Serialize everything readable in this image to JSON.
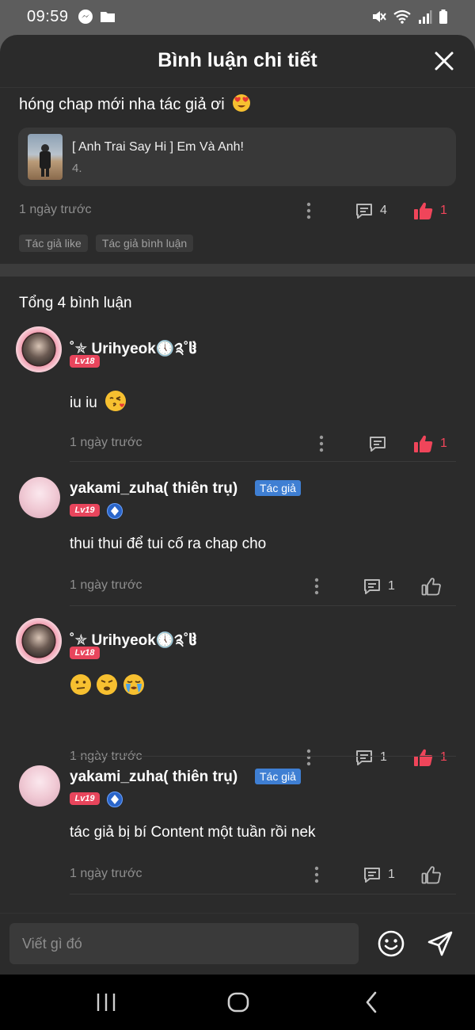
{
  "status_bar": {
    "time": "09:59"
  },
  "header": {
    "title": "Bình luận chi tiết"
  },
  "parent_comment": {
    "text": "hóng chap mới nha tác giả ơi",
    "story_title": "[ Anh Trai Say Hi ] Em Và Anh!",
    "story_chapter": "4.",
    "time": "1 ngày trước",
    "reply_count": "4",
    "like_count": "1",
    "tags": [
      "Tác giả like",
      "Tác giả bình luận"
    ]
  },
  "replies": {
    "total_label": "Tổng 4 bình luận",
    "items": [
      {
        "username": "˚✯ Urihyeok🕔༉˚ჱ̒",
        "level": "Lv18",
        "text": "iu iu",
        "time": "1 ngày trước",
        "reply_count": "",
        "like_count": "1",
        "liked": true
      },
      {
        "username": "yakami_zuha( thiên trụ)",
        "author_badge": "Tác giả",
        "level": "Lv19",
        "text": "thui thui để tui cố ra chap cho",
        "time": "1 ngày trước",
        "reply_count": "1",
        "like_count": "",
        "liked": false
      },
      {
        "username": "˚✯ Urihyeok🕔༉˚ჱ̒",
        "level": "Lv18",
        "text": "",
        "time": "1 ngày trước",
        "reply_count": "1",
        "like_count": "1",
        "liked": true
      },
      {
        "username": "yakami_zuha( thiên trụ)",
        "author_badge": "Tác giả",
        "level": "Lv19",
        "text": "tác giả bị bí Content một tuần rồi nek",
        "time": "1 ngày trước",
        "reply_count": "1",
        "like_count": "",
        "liked": false
      }
    ]
  },
  "input": {
    "placeholder": "Viết gì đó"
  },
  "colors": {
    "accent_red": "#f0455a",
    "author_blue": "#3f7fd3",
    "sheet_bg": "#2b2b2b"
  },
  "icons": [
    "messenger-icon",
    "folder-icon",
    "mute-icon",
    "wifi-icon",
    "signal-icon",
    "battery-icon",
    "close-icon",
    "more-vertical-icon",
    "comment-icon",
    "thumb-up-icon",
    "emoji-icon",
    "send-icon",
    "recents-icon",
    "home-icon",
    "back-icon"
  ]
}
